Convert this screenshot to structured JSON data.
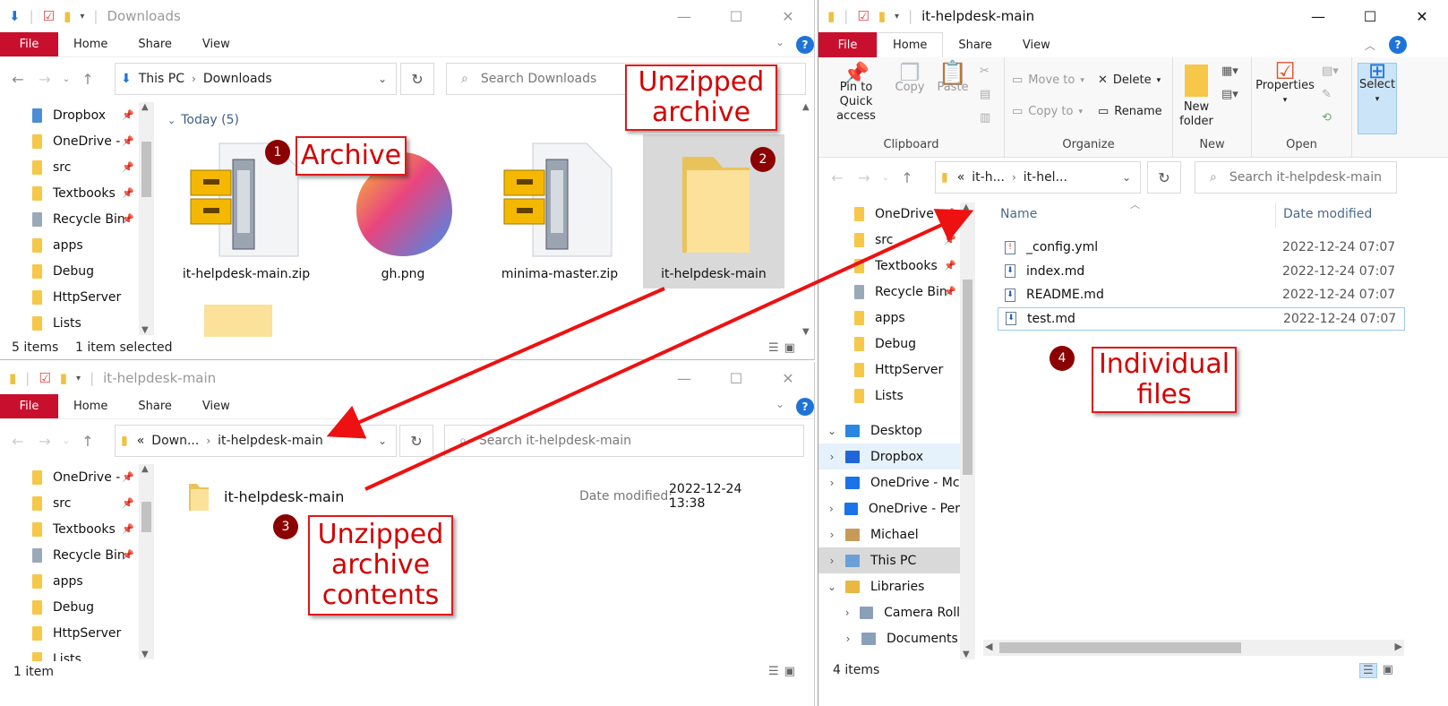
{
  "colors": {
    "accent": "#c8102e",
    "callout": "#e01818",
    "badge": "#8b0000",
    "link": "#3a5f8a"
  },
  "win1": {
    "title": "Downloads",
    "tabs": {
      "file": "File",
      "home": "Home",
      "share": "Share",
      "view": "View"
    },
    "address": [
      "This PC",
      "Downloads"
    ],
    "search_placeholder": "Search Downloads",
    "group_header": "Today (5)",
    "nav": [
      {
        "label": "Dropbox",
        "icon": "dropbox-icon",
        "pinned": true
      },
      {
        "label": "OneDrive -",
        "icon": "folder-icon",
        "pinned": true
      },
      {
        "label": "src",
        "icon": "folder-icon",
        "pinned": true
      },
      {
        "label": "Textbooks",
        "icon": "folder-icon",
        "pinned": true
      },
      {
        "label": "Recycle Bin",
        "icon": "recycle-bin-icon",
        "pinned": true
      },
      {
        "label": "apps",
        "icon": "folder-icon",
        "pinned": false
      },
      {
        "label": "Debug",
        "icon": "folder-icon",
        "pinned": false
      },
      {
        "label": "HttpServer",
        "icon": "folder-icon",
        "pinned": false
      },
      {
        "label": "Lists",
        "icon": "folder-icon",
        "pinned": false
      }
    ],
    "files": [
      {
        "name": "it-helpdesk-main.zip",
        "icon": "zip-archive-icon"
      },
      {
        "name": "gh.png",
        "icon": "image-icon"
      },
      {
        "name": "minima-master.zip",
        "icon": "zip-archive-icon"
      },
      {
        "name": "it-helpdesk-main",
        "icon": "folder-icon",
        "selected": true
      }
    ],
    "status_items": "5 items",
    "status_selected": "1 item selected"
  },
  "win2": {
    "title": "it-helpdesk-main",
    "tabs": {
      "file": "File",
      "home": "Home",
      "share": "Share",
      "view": "View"
    },
    "address_prefix": "«",
    "address": [
      "Down...",
      "it-helpdesk-main"
    ],
    "search_placeholder": "Search it-helpdesk-main",
    "nav": [
      {
        "label": "OneDrive -",
        "icon": "folder-icon",
        "pinned": true
      },
      {
        "label": "src",
        "icon": "folder-icon",
        "pinned": true
      },
      {
        "label": "Textbooks",
        "icon": "folder-icon",
        "pinned": true
      },
      {
        "label": "Recycle Bin",
        "icon": "recycle-bin-icon",
        "pinned": true
      },
      {
        "label": "apps",
        "icon": "folder-icon",
        "pinned": false
      },
      {
        "label": "Debug",
        "icon": "folder-icon",
        "pinned": false
      },
      {
        "label": "HttpServer",
        "icon": "folder-icon",
        "pinned": false
      },
      {
        "label": "Lists",
        "icon": "folder-icon",
        "pinned": false
      }
    ],
    "item_name": "it-helpdesk-main",
    "item_date_label": "Date modified:",
    "item_date": "2022-12-24 13:38",
    "status_items": "1 item"
  },
  "win3": {
    "title": "it-helpdesk-main",
    "tabs": {
      "file": "File",
      "home": "Home",
      "share": "Share",
      "view": "View"
    },
    "ribbon": {
      "pin": "Pin to Quick access",
      "copy": "Copy",
      "paste": "Paste",
      "clipboard": "Clipboard",
      "move_to": "Move to",
      "copy_to": "Copy to",
      "delete": "Delete",
      "rename": "Rename",
      "organize": "Organize",
      "new_folder": "New folder",
      "new": "New",
      "properties": "Properties",
      "open": "Open",
      "select": "Select"
    },
    "address_prefix": "«",
    "address": [
      "it-h...",
      "it-hel..."
    ],
    "search_placeholder": "Search it-helpdesk-main",
    "nav": [
      {
        "label": "OneDrive -",
        "icon": "folder-icon",
        "pinned": true
      },
      {
        "label": "src",
        "icon": "folder-icon",
        "pinned": true
      },
      {
        "label": "Textbooks",
        "icon": "folder-icon",
        "pinned": true
      },
      {
        "label": "Recycle Bin",
        "icon": "recycle-bin-icon",
        "pinned": true
      },
      {
        "label": "apps",
        "icon": "folder-icon",
        "pinned": false
      },
      {
        "label": "Debug",
        "icon": "folder-icon",
        "pinned": false
      },
      {
        "label": "HttpServer",
        "icon": "folder-icon",
        "pinned": false
      },
      {
        "label": "Lists",
        "icon": "folder-icon",
        "pinned": false
      }
    ],
    "tree": [
      {
        "label": "Desktop",
        "icon": "desktop-icon",
        "expander": "expanded"
      },
      {
        "label": "Dropbox",
        "icon": "dropbox-icon",
        "expander": "collapsed",
        "highlight": true
      },
      {
        "label": "OneDrive - Mc",
        "icon": "onedrive-icon",
        "expander": "collapsed"
      },
      {
        "label": "OneDrive - Per",
        "icon": "onedrive-icon",
        "expander": "collapsed"
      },
      {
        "label": "Michael",
        "icon": "user-icon",
        "expander": "collapsed"
      },
      {
        "label": "This PC",
        "icon": "this-pc-icon",
        "expander": "collapsed",
        "selected": true
      },
      {
        "label": "Libraries",
        "icon": "libraries-icon",
        "expander": "expanded"
      },
      {
        "label": "Camera Roll",
        "icon": "camera-roll-icon",
        "expander": "collapsed",
        "indent": true
      },
      {
        "label": "Documents",
        "icon": "documents-icon",
        "expander": "collapsed",
        "indent": true
      }
    ],
    "columns": {
      "name": "Name",
      "date": "Date modified"
    },
    "files": [
      {
        "name": "_config.yml",
        "date": "2022-12-24 07:07",
        "icon": "yml-file-icon"
      },
      {
        "name": "index.md",
        "date": "2022-12-24 07:07",
        "icon": "md-file-icon"
      },
      {
        "name": "README.md",
        "date": "2022-12-24 07:07",
        "icon": "md-file-icon"
      },
      {
        "name": "test.md",
        "date": "2022-12-24 07:07",
        "icon": "md-file-icon"
      }
    ],
    "status_items": "4 items"
  },
  "callouts": {
    "archive": "Archive",
    "unzipped_archive": "Unzipped archive",
    "unzipped_contents": "Unzipped archive contents",
    "individual_files": "Individual files"
  },
  "badges": [
    "1",
    "2",
    "3",
    "4"
  ]
}
